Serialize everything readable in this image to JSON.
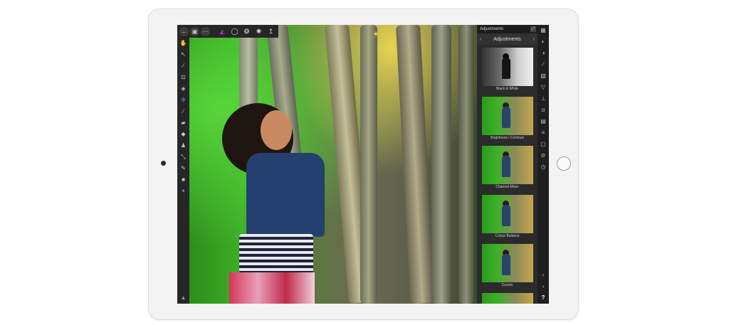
{
  "toolbar": {
    "buttons": [
      {
        "icon": "back-arrow-icon",
        "glyph": "←"
      },
      {
        "icon": "document-icon",
        "glyph": "▣"
      },
      {
        "icon": "more-icon",
        "glyph": "⋯"
      }
    ],
    "personas": [
      {
        "icon": "photo-persona-icon",
        "glyph": "◭"
      },
      {
        "icon": "selection-icon",
        "glyph": "◯"
      },
      {
        "icon": "liquify-icon",
        "glyph": "❂"
      },
      {
        "icon": "develop-icon",
        "glyph": "✺"
      },
      {
        "icon": "export-icon",
        "glyph": "↥"
      }
    ]
  },
  "tools": [
    {
      "icon": "hand-tool-icon",
      "glyph": "✋"
    },
    {
      "icon": "move-tool-icon",
      "glyph": "↖"
    },
    {
      "icon": "color-picker-icon",
      "glyph": "⁄"
    },
    {
      "icon": "crop-tool-icon",
      "glyph": "⊡"
    },
    {
      "icon": "selection-brush-icon",
      "glyph": "◈"
    },
    {
      "icon": "flood-select-icon",
      "glyph": "✲"
    },
    {
      "icon": "paint-brush-icon",
      "glyph": "⁄"
    },
    {
      "icon": "erase-brush-icon",
      "glyph": "▰"
    },
    {
      "icon": "fill-tool-icon",
      "glyph": "◆"
    },
    {
      "icon": "clone-tool-icon",
      "glyph": "♟"
    },
    {
      "icon": "retouch-tool-icon",
      "glyph": "⤡"
    },
    {
      "icon": "smudge-tool-icon",
      "glyph": "✎"
    },
    {
      "icon": "rectangle-tool-icon",
      "glyph": "■"
    },
    {
      "icon": "vector-tool-icon",
      "glyph": "✦"
    }
  ],
  "adjustments_panel": {
    "header": "Adjustments",
    "nav_title": "Adjustments",
    "prev_glyph": "‹",
    "next_glyph": "›",
    "items": [
      {
        "label": "Black & White"
      },
      {
        "label": "Brightness / Contrast"
      },
      {
        "label": "Channel Mixer"
      },
      {
        "label": "Colour Balance"
      },
      {
        "label": "Curves"
      }
    ]
  },
  "right_tools": [
    {
      "icon": "layers-icon",
      "glyph": "▦"
    },
    {
      "icon": "brushes-icon",
      "glyph": "◐"
    },
    {
      "icon": "adjustments-icon",
      "glyph": "◑"
    },
    {
      "icon": "brush-settings-icon",
      "glyph": "⁄"
    },
    {
      "icon": "fx-icon",
      "glyph": "▧"
    },
    {
      "icon": "filter-icon",
      "glyph": "▽"
    },
    {
      "icon": "live-filters-icon",
      "glyph": "⟂"
    },
    {
      "icon": "text-style-icon",
      "glyph": "α"
    },
    {
      "icon": "channels-icon",
      "glyph": "▤"
    },
    {
      "icon": "histogram-icon",
      "glyph": "≡"
    },
    {
      "icon": "transform-icon",
      "glyph": "▢"
    },
    {
      "icon": "navigator-icon",
      "glyph": "⊘"
    },
    {
      "icon": "history-icon",
      "glyph": "◷"
    }
  ],
  "right_bottom": {
    "prev_glyph": "‹",
    "next_glyph": "›",
    "help": "?"
  },
  "bottom_tool_glyph": "▲"
}
